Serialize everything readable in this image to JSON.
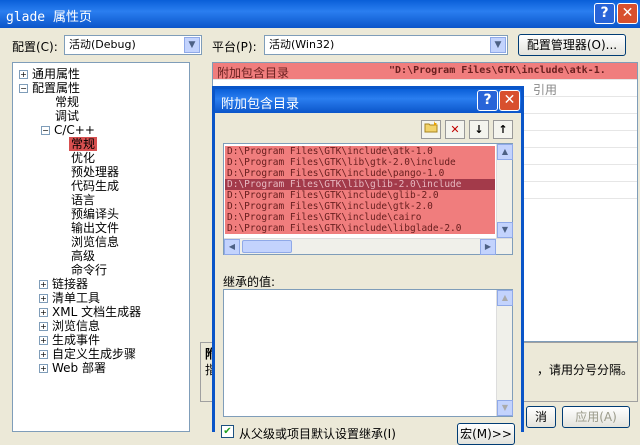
{
  "window": {
    "title": "glade 属性页"
  },
  "config_bar": {
    "config_label": "配置(C):",
    "config_value": "活动(Debug)",
    "platform_label": "平台(P):",
    "platform_value": "活动(Win32)",
    "manager_button": "配置管理器(O)..."
  },
  "tree": {
    "common_props": "通用属性",
    "config_props": "配置属性",
    "general": "常规",
    "debug": "调试",
    "cpp": "C/C++",
    "cpp_general": "常规",
    "optimization": "优化",
    "preprocessor": "预处理器",
    "codegen": "代码生成",
    "language": "语言",
    "precompiled": "预编译头",
    "output_files": "输出文件",
    "browse_info": "浏览信息",
    "advanced": "高级",
    "command_line": "命令行",
    "linker": "链接器",
    "manifest": "清单工具",
    "xml_gen": "XML 文档生成器",
    "browse_info2": "浏览信息",
    "build_events": "生成事件",
    "custom_build": "自定义生成步骤",
    "web_deploy": "Web 部署"
  },
  "grid": {
    "row1_name": "附加包含目录",
    "row1_value": "\"D:\\Program Files\\GTK\\include\\atk-1.",
    "row2_value": "引用"
  },
  "description": {
    "title": "附",
    "text_start": "指",
    "text_end": "，请用分号分隔。"
  },
  "footer": {
    "apply_button": "应用(A)",
    "partial_button": "消"
  },
  "dialog": {
    "title": "附加包含目录",
    "dirs": [
      "D:\\Program Files\\GTK\\include\\atk-1.0",
      "D:\\Program Files\\GTK\\lib\\gtk-2.0\\include",
      "D:\\Program Files\\GTK\\include\\pango-1.0",
      "D:\\Program Files\\GTK\\lib\\glib-2.0\\include",
      "D:\\Program Files\\GTK\\include\\glib-2.0",
      "D:\\Program Files\\GTK\\include\\gtk-2.0",
      "D:\\Program Files\\GTK\\include\\cairo",
      "D:\\Program Files\\GTK\\include\\libglade-2.0"
    ],
    "inherited_label": "继承的值:",
    "inherit_checkbox": "从父级或项目默认设置继承(I)",
    "macro_button": "宏(M)>>"
  }
}
